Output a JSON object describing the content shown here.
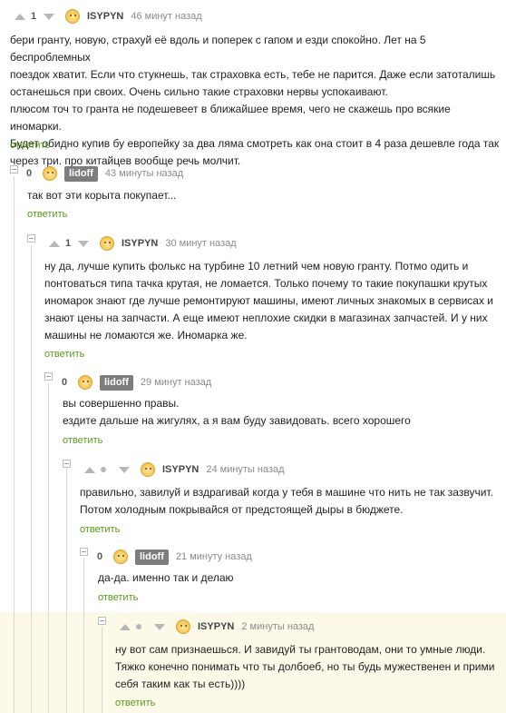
{
  "comments": [
    {
      "rating": "1",
      "author": "ISYPYN",
      "time": "46 минут назад",
      "text": [
        "бери гранту, новую, страхуй её вдоль и поперек с гапом и езди спокойно. Лет на 5 беспроблемных",
        "поездок хватит. Если что стукнешь, так страховка есть, тебе не парится. Даже если затоталишь",
        "останешься при своих. Очень сильно такие страховки нервы успокаивают.",
        "плюсом точ то гранта не подешевеет в ближайшее время, чего не скажешь про всякие иномарки.",
        "Будет обидно купив бу европейку за два ляма смотреть как она стоит в 4 раза дешевле года так",
        "через три. про китайцев вообще речь молчит."
      ],
      "reply": "ответить"
    },
    {
      "rating": "0",
      "author": "lidoff",
      "time": "43 минуты назад",
      "text": [
        "так вот эти корыта покупает..."
      ],
      "reply": "ответить"
    },
    {
      "rating": "1",
      "author": "ISYPYN",
      "time": "30 минут назад",
      "text": [
        "ну да, лучше купить фолькс на турбине 10 летний чем новую гранту. Потмо одить и",
        "понтоваться типа тачка крутая, не ломается. Только почему то такие покупашки крутых",
        "иномарок знают где лучше ремонтируют машины, имеют личных знакомых в сервисах и",
        "знают цены на запчасти. А еще имеют неплохие скидки в магазинах запчастей.  И у них",
        "машины не ломаются же. Иномарка же."
      ],
      "reply": "ответить"
    },
    {
      "rating": "0",
      "author": "lidoff",
      "time": "29 минут назад",
      "text": [
        "вы совершенно правы.",
        "ездите дальше на жигулях, а я вам буду завидовать. всего хорошего"
      ],
      "reply": "ответить"
    },
    {
      "rating": "",
      "author": "ISYPYN",
      "time": "24 минуты назад",
      "text": [
        "правильно, завилуй и вздрагивай когда у тебя в машине что нить не так зазвучит.",
        "Потом холодным покрывайся от предстоящей дыры в бюджете."
      ],
      "reply": "ответить"
    },
    {
      "rating": "0",
      "author": "lidoff",
      "time": "21 минуту назад",
      "text": [
        "да-да. именно так и делаю"
      ],
      "reply": "ответить"
    },
    {
      "rating": "",
      "author": "ISYPYN",
      "time": "2 минуты назад",
      "text": [
        "ну вот сам признаешься. И завидуй ты грантоводам, они то умные люди.",
        "Тяжко конечно понимать что ты долбоеб, но ты будь мужественен и прими",
        "себя таким как ты есть))))"
      ],
      "reply": "ответить"
    }
  ],
  "colors": {
    "reply_link": "#5a9a1a",
    "highlight_bg": "#fdf9e8",
    "author_badge_bg": "#7d7d7d"
  },
  "icons": {
    "vote_up": "arrow-up-icon",
    "vote_down": "arrow-down-icon",
    "collapse": "collapse-icon",
    "avatar": "avatar-icon"
  }
}
